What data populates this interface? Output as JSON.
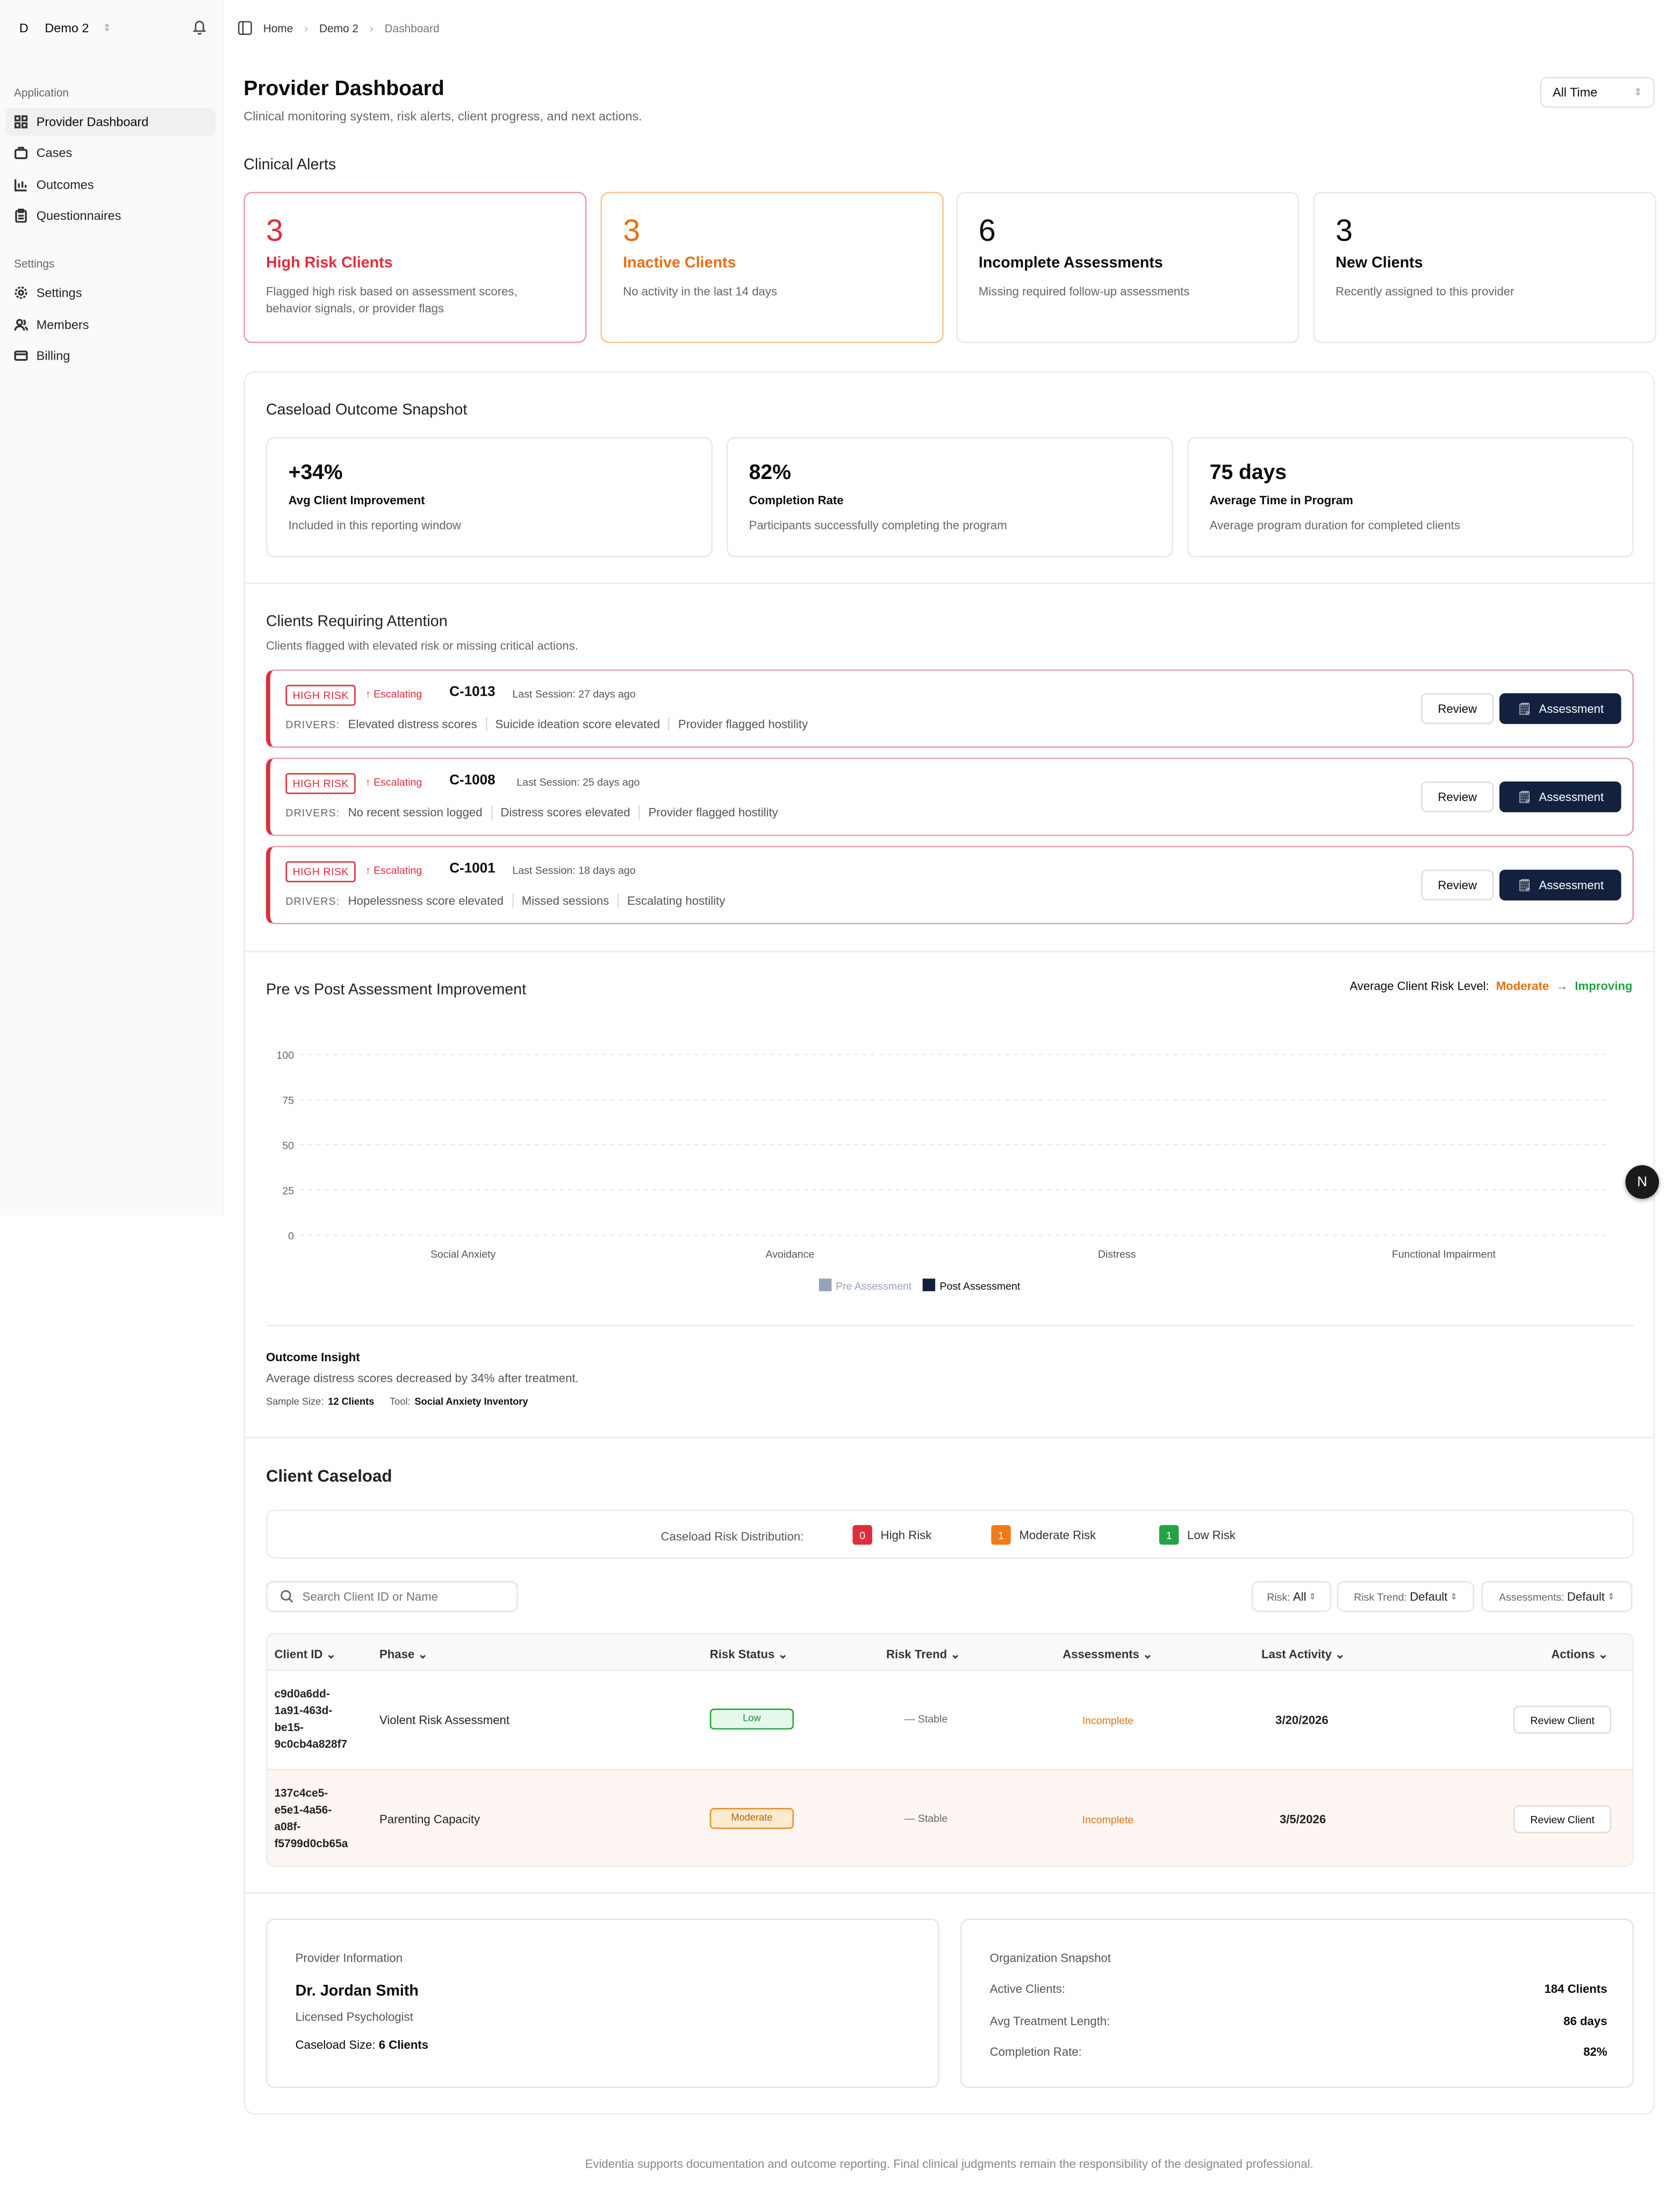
{
  "sidebar": {
    "org": {
      "initial": "D",
      "name": "Demo 2"
    },
    "groups": [
      {
        "label": "Application",
        "items": [
          {
            "label": "Provider Dashboard",
            "icon": "layout-grid-icon",
            "active": true
          },
          {
            "label": "Cases",
            "icon": "briefcase-icon"
          },
          {
            "label": "Outcomes",
            "icon": "bar-chart-icon"
          },
          {
            "label": "Questionnaires",
            "icon": "clipboard-icon"
          }
        ]
      },
      {
        "label": "Settings",
        "items": [
          {
            "label": "Settings",
            "icon": "gear-icon"
          },
          {
            "label": "Members",
            "icon": "users-icon"
          },
          {
            "label": "Billing",
            "icon": "credit-card-icon"
          }
        ]
      }
    ]
  },
  "breadcrumb": [
    "Home",
    "Demo 2",
    "Dashboard"
  ],
  "page": {
    "title": "Provider Dashboard",
    "subtitle": "Clinical monitoring system, risk alerts, client progress, and next actions.",
    "time_filter": "All Time"
  },
  "alerts": {
    "heading": "Clinical Alerts",
    "cards": [
      {
        "count": "3",
        "title": "High Risk Clients",
        "desc": "Flagged high risk based on assessment scores, behavior signals, or provider flags",
        "tone": "#e02d3c"
      },
      {
        "count": "3",
        "title": "Inactive Clients",
        "desc": "No activity in the last 14 days",
        "tone": "#ea6e12"
      },
      {
        "count": "6",
        "title": "Incomplete Assessments",
        "desc": "Missing required follow-up assessments"
      },
      {
        "count": "3",
        "title": "New Clients",
        "desc": "Recently assigned to this provider"
      }
    ]
  },
  "snapshot": {
    "heading": "Caseload Outcome Snapshot",
    "stats": [
      {
        "value": "+34%",
        "label": "Avg Client Improvement",
        "desc": "Included in this reporting window"
      },
      {
        "value": "82%",
        "label": "Completion Rate",
        "desc": "Participants successfully completing the program"
      },
      {
        "value": "75 days",
        "label": "Average Time in Program",
        "desc": "Average program duration for completed clients"
      }
    ]
  },
  "attention": {
    "heading": "Clients Requiring Attention",
    "subheading": "Clients flagged with elevated risk or missing critical actions.",
    "risk_label": "HIGH RISK",
    "trend_label": "Escalating",
    "drivers_label": "DRIVERS:",
    "review_label": "Review",
    "assessment_label": "Assessment",
    "clients": [
      {
        "id": "C-1013",
        "last_session": "Last Session: 27 days ago",
        "drivers": [
          "Elevated distress scores",
          "Suicide ideation score elevated",
          "Provider flagged hostility"
        ]
      },
      {
        "id": "C-1008",
        "last_session": "Last Session: 25 days ago",
        "drivers": [
          "No recent session logged",
          "Distress scores elevated",
          "Provider flagged hostility"
        ]
      },
      {
        "id": "C-1001",
        "last_session": "Last Session: 18 days ago",
        "drivers": [
          "Hopelessness score elevated",
          "Missed sessions",
          "Escalating hostility"
        ]
      }
    ]
  },
  "improvement": {
    "heading": "Pre vs Post Assessment Improvement",
    "risk_level_label": "Average Client Risk Level:",
    "risk_from": "Moderate",
    "risk_to": "Improving",
    "insight_title": "Outcome Insight",
    "insight_text": "Average distress scores decreased by 34% after treatment.",
    "sample_label": "Sample Size:",
    "sample_value": "12 Clients",
    "tool_label": "Tool:",
    "tool_value": "Social Anxiety Inventory"
  },
  "chart_data": {
    "type": "bar",
    "categories": [
      "Social Anxiety",
      "Avoidance",
      "Distress",
      "Functional Impairment"
    ],
    "series": [
      {
        "name": "Pre Assessment",
        "values": [
          0,
          0,
          0,
          0
        ],
        "color": "#94a3b8"
      },
      {
        "name": "Post Assessment",
        "values": [
          0,
          0,
          0,
          0
        ],
        "color": "#0f1f3d"
      }
    ],
    "yticks": [
      100,
      75,
      50,
      25,
      0
    ],
    "ylim": [
      0,
      100
    ],
    "grid": true,
    "legend": "bottom"
  },
  "caseload": {
    "heading": "Client Caseload",
    "distribution_label": "Caseload Risk Distribution:",
    "distribution": [
      {
        "count": "0",
        "label": "High Risk",
        "color": "#e02d3c"
      },
      {
        "count": "1",
        "label": "Moderate Risk",
        "color": "#f07a18"
      },
      {
        "count": "1",
        "label": "Low Risk",
        "color": "#22a345"
      }
    ],
    "search_placeholder": "Search Client ID or Name",
    "filters": [
      {
        "label": "Risk:",
        "value": "All"
      },
      {
        "label": "Risk Trend:",
        "value": "Default"
      },
      {
        "label": "Assessments:",
        "value": "Default"
      }
    ],
    "columns": [
      "Client ID",
      "Phase",
      "Risk Status",
      "Risk Trend",
      "Assessments",
      "Last Activity",
      "Actions"
    ],
    "rows": [
      {
        "id_lines": [
          "c9d0a6dd-",
          "1a91-463d-",
          "be15-",
          "9c0cb4a828f7"
        ],
        "phase": "Violent Risk Assessment",
        "risk": "Low",
        "trend": "Stable",
        "assessments": "Incomplete",
        "last_activity": "3/20/2026",
        "action": "Review Client"
      },
      {
        "id_lines": [
          "137c4ce5-",
          "e5e1-4a56-",
          "a08f-",
          "f5799d0cb65a"
        ],
        "phase": "Parenting Capacity",
        "risk": "Moderate",
        "trend": "Stable",
        "assessments": "Incomplete",
        "last_activity": "3/5/2026",
        "action": "Review Client"
      }
    ]
  },
  "provider": {
    "heading": "Provider Information",
    "name": "Dr. Jordan Smith",
    "role": "Licensed Psychologist",
    "caseload_label": "Caseload Size:",
    "caseload_value": "6 Clients"
  },
  "organization": {
    "heading": "Organization Snapshot",
    "rows": [
      {
        "label": "Active Clients:",
        "value": "184 Clients"
      },
      {
        "label": "Avg Treatment Length:",
        "value": "86 days"
      },
      {
        "label": "Completion Rate:",
        "value": "82%"
      }
    ]
  },
  "assistant_initial": "N",
  "footer": "Evidentia supports documentation and outcome reporting. Final clinical judgments remain the responsibility of the designated professional."
}
